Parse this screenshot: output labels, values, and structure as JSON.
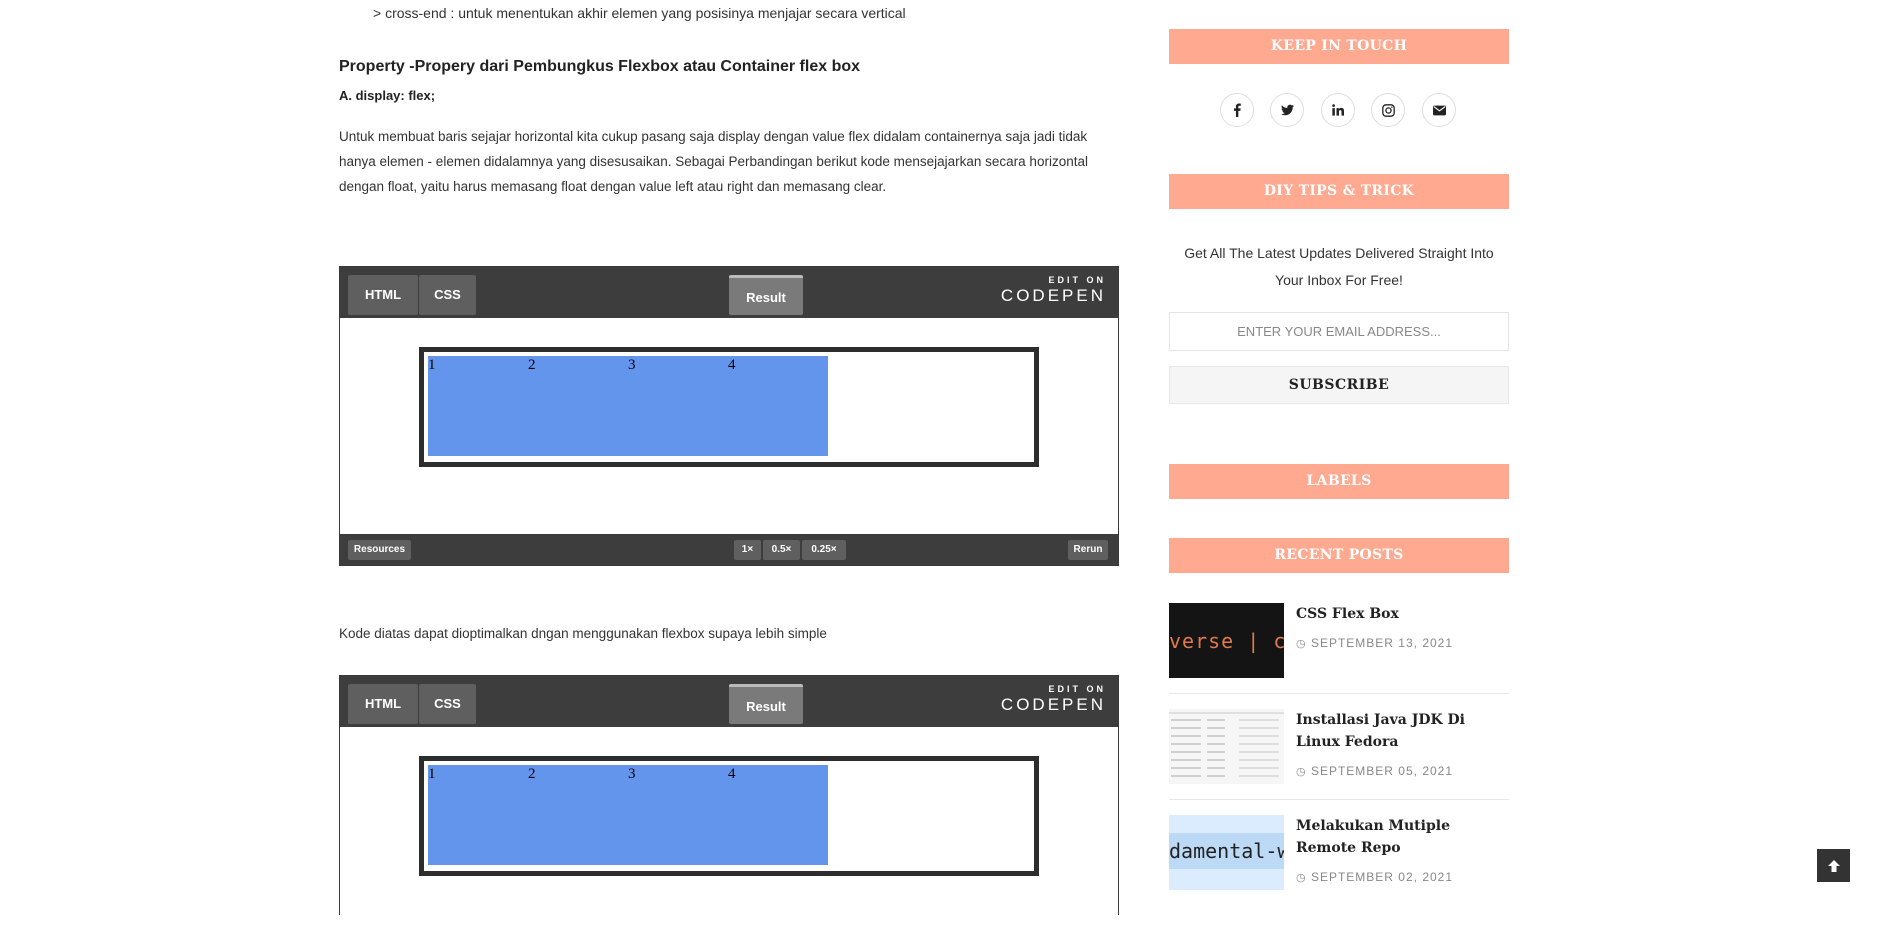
{
  "article": {
    "bullet_text": "> cross-end : untuk menentukan akhir elemen yang posisinya menjajar secara vertical",
    "section_title": "Property -Propery  dari Pembungkus Flexbox atau Container flex box",
    "sub_title": "A. display: flex;",
    "paragraph1": "Untuk membuat baris sejajar horizontal kita cukup pasang saja display dengan value flex didalam containernya saja jadi tidak hanya elemen - elemen didalamnya yang disesusaikan. Sebagai Perbandingan berikut kode mensejajarkan secara horizontal  dengan float, yaitu harus memasang float dengan value left atau right dan memasang clear.",
    "paragraph2": "Kode diatas dapat dioptimalkan dngan menggunakan flexbox supaya lebih simple"
  },
  "codepen": {
    "tab_html": "HTML",
    "tab_css": "CSS",
    "tab_result": "Result",
    "edit_on": "EDIT ON",
    "brand": "CODEPEN",
    "resources": "Resources",
    "zoom_1x": "1×",
    "zoom_05x": "0.5×",
    "zoom_025x": "0.25×",
    "rerun": "Rerun",
    "items": [
      "1",
      "2",
      "3",
      "4"
    ],
    "fill_color": "#6495ed"
  },
  "sidebar": {
    "keep_in_touch": "KEEP IN TOUCH",
    "social": [
      "facebook-icon",
      "twitter-icon",
      "linkedin-icon",
      "instagram-icon",
      "envelope-icon"
    ],
    "diy_title": "DIY TIPS & TRICK",
    "diy_text": "Get All The Latest Updates Delivered Straight Into Your Inbox For Free!",
    "email_placeholder": "ENTER YOUR EMAIL ADDRESS...",
    "subscribe": "SUBSCRIBE",
    "labels_title": "LABELS",
    "recent_title": "RECENT POSTS",
    "accent_color": "#fea990",
    "posts": [
      {
        "title": "CSS Flex Box",
        "date": "SEPTEMBER 13, 2021",
        "thumb_text": "verse | co"
      },
      {
        "title": "Installasi Java JDK Di Linux Fedora",
        "date": "SEPTEMBER 05, 2021"
      },
      {
        "title": "Melakukan Mutiple Remote Repo",
        "date": "SEPTEMBER 02, 2021",
        "thumb_text": "damental-w"
      }
    ]
  }
}
